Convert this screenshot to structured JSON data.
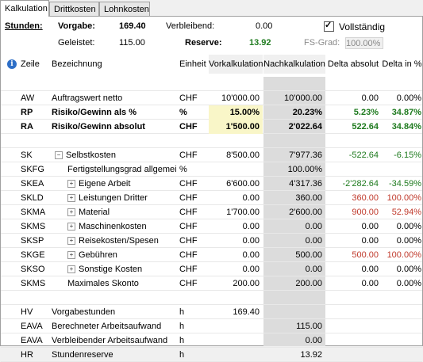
{
  "tabs": [
    {
      "label": "Kalkulation",
      "active": true
    },
    {
      "label": "Drittkosten",
      "active": false
    },
    {
      "label": "Lohnkosten",
      "active": false
    }
  ],
  "summary": {
    "stunden_label": "Stunden:",
    "vorgabe_label": "Vorgabe:",
    "vorgabe_value": "169.40",
    "verbleibend_label": "Verbleibend:",
    "verbleibend_value": "0.00",
    "vollstaendig_label": "Vollständig",
    "vollstaendig_checked": true,
    "geleistet_label": "Geleistet:",
    "geleistet_value": "115.00",
    "reserve_label": "Reserve:",
    "reserve_value": "13.92",
    "fsgrad_label": "FS-Grad:",
    "fsgrad_value": "100.00%"
  },
  "columns": {
    "zeile": "Zeile",
    "bezeichnung": "Bezeichnung",
    "einheit": "Einheit",
    "vorkalkulation": "Vorkalkulation",
    "nachkalkulation": "Nachkalkulation",
    "delta_absolut": "Delta absolut",
    "delta_prozent": "Delta in %"
  },
  "rows": [
    {
      "code": "",
      "desc": "",
      "unit": "",
      "vk": "",
      "nk": "",
      "da": "",
      "dp": ""
    },
    {
      "code": "AW",
      "desc": "Auftragswert netto",
      "unit": "CHF",
      "vk": "10'000.00",
      "nk": "10'000.00",
      "da": "0.00",
      "dp": "0.00%"
    },
    {
      "code": "RP",
      "desc": "Risiko/Gewinn als %",
      "unit": "%",
      "vk": "15.00%",
      "nk": "20.23%",
      "da": "5.23%",
      "dp": "34.87%",
      "bold": true,
      "hl": true,
      "color": "green"
    },
    {
      "code": "RA",
      "desc": "Risiko/Gewinn absolut",
      "unit": "CHF",
      "vk": "1'500.00",
      "nk": "2'022.64",
      "da": "522.64",
      "dp": "34.84%",
      "bold": true,
      "hl": true,
      "color": "green"
    },
    {
      "code": "",
      "desc": "",
      "unit": "",
      "vk": "",
      "nk": "",
      "da": "",
      "dp": ""
    },
    {
      "code": "SK",
      "desc": "Selbstkosten",
      "unit": "CHF",
      "vk": "8'500.00",
      "nk": "7'977.36",
      "da": "-522.64",
      "dp": "-6.15%",
      "color": "green",
      "exp": "minus",
      "indent": 0
    },
    {
      "code": "SKFG",
      "desc": "Fertigstellungsgrad allgemein",
      "unit": "%",
      "vk": "",
      "nk": "100.00%",
      "da": "",
      "dp": "",
      "indent": 1
    },
    {
      "code": "SKEA",
      "desc": "Eigene Arbeit",
      "unit": "CHF",
      "vk": "6'600.00",
      "nk": "4'317.36",
      "da": "-2'282.64",
      "dp": "-34.59%",
      "color": "green",
      "exp": "plus",
      "indent": 1
    },
    {
      "code": "SKLD",
      "desc": "Leistungen Dritter",
      "unit": "CHF",
      "vk": "0.00",
      "nk": "360.00",
      "da": "360.00",
      "dp": "100.00%",
      "color": "red",
      "exp": "plus",
      "indent": 1
    },
    {
      "code": "SKMA",
      "desc": "Material",
      "unit": "CHF",
      "vk": "1'700.00",
      "nk": "2'600.00",
      "da": "900.00",
      "dp": "52.94%",
      "color": "red",
      "exp": "plus",
      "indent": 1
    },
    {
      "code": "SKMS",
      "desc": "Maschinenkosten",
      "unit": "CHF",
      "vk": "0.00",
      "nk": "0.00",
      "da": "0.00",
      "dp": "0.00%",
      "exp": "plus",
      "indent": 1
    },
    {
      "code": "SKSP",
      "desc": "Reisekosten/Spesen",
      "unit": "CHF",
      "vk": "0.00",
      "nk": "0.00",
      "da": "0.00",
      "dp": "0.00%",
      "exp": "plus",
      "indent": 1
    },
    {
      "code": "SKGE",
      "desc": "Gebühren",
      "unit": "CHF",
      "vk": "0.00",
      "nk": "500.00",
      "da": "500.00",
      "dp": "100.00%",
      "color": "red",
      "exp": "plus",
      "indent": 1
    },
    {
      "code": "SKSO",
      "desc": "Sonstige Kosten",
      "unit": "CHF",
      "vk": "0.00",
      "nk": "0.00",
      "da": "0.00",
      "dp": "0.00%",
      "exp": "plus",
      "indent": 1
    },
    {
      "code": "SKMS",
      "desc": "Maximales Skonto",
      "unit": "CHF",
      "vk": "200.00",
      "nk": "200.00",
      "da": "0.00",
      "dp": "0.00%",
      "indent": 1
    },
    {
      "code": "",
      "desc": "",
      "unit": "",
      "vk": "",
      "nk": "",
      "da": "",
      "dp": ""
    },
    {
      "code": "HV",
      "desc": "Vorgabestunden",
      "unit": "h",
      "vk": "169.40",
      "nk": "",
      "da": "",
      "dp": ""
    },
    {
      "code": "EAVA",
      "desc": "Berechneter Arbeitsaufwand",
      "unit": "h",
      "vk": "",
      "nk": "115.00",
      "da": "",
      "dp": ""
    },
    {
      "code": "EAVA",
      "desc": "Verbleibender Arbeitsaufwand",
      "unit": "h",
      "vk": "",
      "nk": "0.00",
      "da": "",
      "dp": ""
    },
    {
      "code": "HR",
      "desc": "Stundenreserve",
      "unit": "h",
      "vk": "",
      "nk": "13.92",
      "da": "",
      "dp": ""
    }
  ],
  "colors": {
    "highlight": "#f9f6c8",
    "nachkalk_bg": "#dcdcdc",
    "positive": "#1e7a1e",
    "negative": "#c0392b",
    "info_icon": "#2e6fc7"
  }
}
